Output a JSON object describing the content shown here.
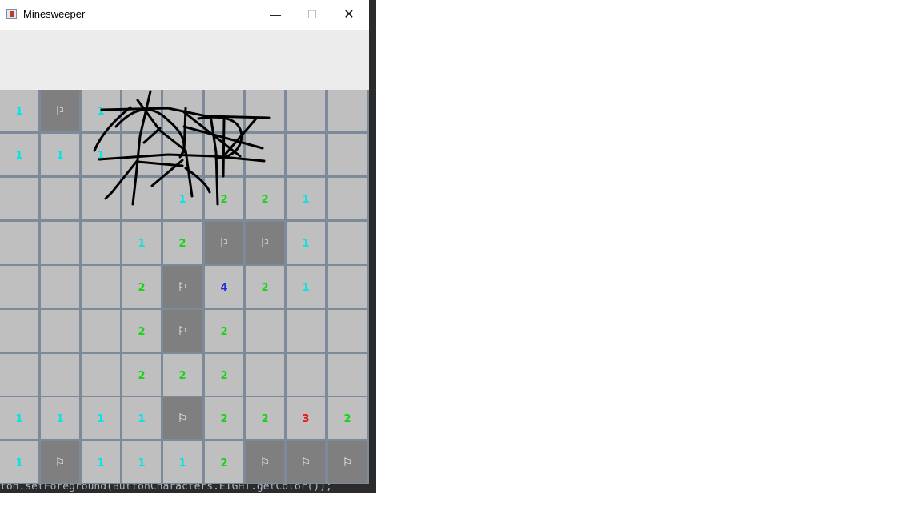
{
  "window": {
    "title": "Minesweeper",
    "minimize": "—",
    "maximize": "☐",
    "close": "✕"
  },
  "colors": {
    "1": "#00e5e5",
    "2": "#16d416",
    "3": "#ee1111",
    "4": "#1a2be0",
    "F": "#ffffff"
  },
  "board": {
    "rows": [
      [
        "1",
        "F",
        "1",
        "",
        "",
        "",
        "",
        "",
        ""
      ],
      [
        "1",
        "1",
        "1",
        "",
        "",
        "",
        "",
        "",
        ""
      ],
      [
        "",
        "",
        "",
        "",
        "1",
        "2",
        "2",
        "1",
        ""
      ],
      [
        "",
        "",
        "",
        "1",
        "2",
        "F",
        "F",
        "1",
        ""
      ],
      [
        "",
        "",
        "",
        "2",
        "F",
        "4",
        "2",
        "1",
        ""
      ],
      [
        "",
        "",
        "",
        "2",
        "F",
        "2",
        "",
        "",
        ""
      ],
      [
        "",
        "",
        "",
        "2",
        "2",
        "2",
        "",
        "",
        ""
      ],
      [
        "1",
        "1",
        "1",
        "1",
        "F",
        "2",
        "2",
        "3",
        "2"
      ],
      [
        "1",
        "F",
        "1",
        "1",
        "1",
        "2",
        "F",
        "F",
        "F"
      ]
    ],
    "flag_glyph": "⚐"
  },
  "code_line": "ton.setForeground(ButtonCharacters.EIGHT.getColor());"
}
